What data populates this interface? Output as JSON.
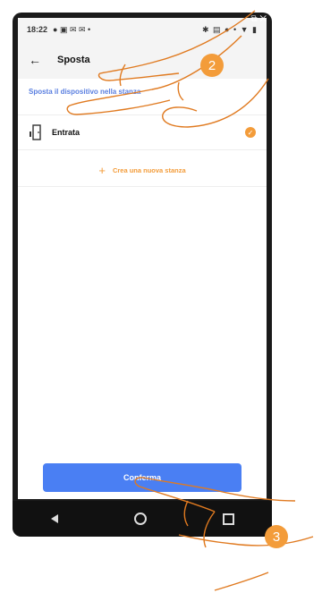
{
  "status": {
    "time": "18:22",
    "left_icons": "● ▣ ✉ ✉ •",
    "right_icons": "✱ ▤ ● • ▼ ▮"
  },
  "header": {
    "back_icon": "back-arrow-icon",
    "title": "Sposta"
  },
  "section": {
    "label": "Sposta il dispositivo nella stanza"
  },
  "rooms": [
    {
      "label": "Entrata",
      "selected": true
    }
  ],
  "create": {
    "label": "Crea una nuova stanza"
  },
  "confirm": {
    "label": "Conferma"
  },
  "badges": {
    "step2": "2",
    "step3": "3"
  },
  "colors": {
    "accent": "#f39c3a",
    "primary": "#4a7ff3",
    "link": "#5a7fe0"
  }
}
